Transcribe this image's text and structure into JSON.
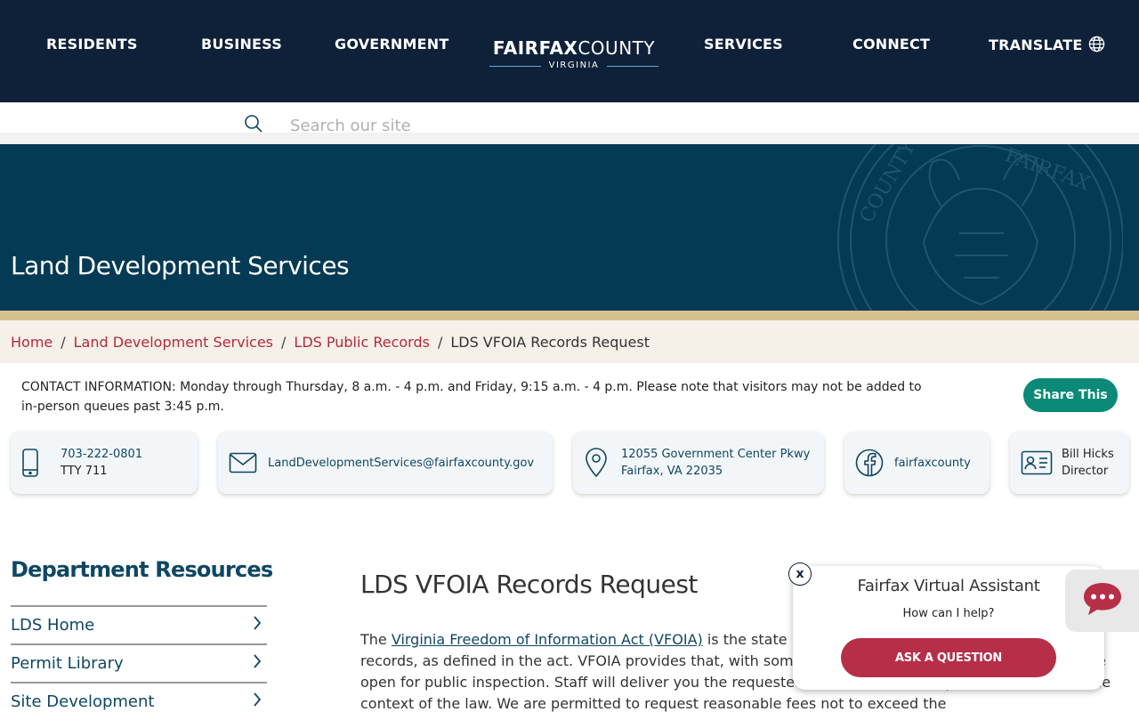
{
  "nav": {
    "items": [
      "RESIDENTS",
      "BUSINESS",
      "GOVERNMENT",
      "SERVICES",
      "CONNECT",
      "TRANSLATE"
    ],
    "logo_bold": "FAIRFAX",
    "logo_light": "COUNTY",
    "logo_sub": "VIRGINIA"
  },
  "search": {
    "placeholder": "Search our site"
  },
  "hero": {
    "title": "Land Development Services"
  },
  "breadcrumb": {
    "items": [
      "Home",
      "Land Development Services",
      "LDS Public Records"
    ],
    "current": "LDS VFOIA Records Request",
    "separator": "/"
  },
  "contact": {
    "info": "CONTACT INFORMATION: Monday through Thursday, 8 a.m. - 4 p.m. and Friday, 9:15 a.m. - 4 p.m. Please note that visitors may not be added to in-person queues past 3:45 p.m.",
    "share_label": "Share This",
    "phone": "703-222-0801",
    "tty": "TTY 711",
    "email": "LandDevelopmentServices@fairfaxcounty.gov",
    "address_line1": "12055 Government Center Pkwy",
    "address_line2": "Fairfax, VA 22035",
    "facebook": "fairfaxcounty",
    "director_name": "Bill Hicks",
    "director_title": "Director"
  },
  "sidebar": {
    "title": "Department Resources",
    "items": [
      "LDS Home",
      "Permit Library",
      "Site Development"
    ]
  },
  "main": {
    "title": "LDS VFOIA Records Request",
    "body_prefix": "The ",
    "body_link": "Virginia Freedom of Information Act (VFOIA)",
    "body_rest": " is the state law that ensures public access to public records, as defined in the act. VFOIA provides that, with some specific exemptions, all public records are open for public inspection. Staff will deliver you the requested records as soon as possible and within the context of the law. We are permitted to request reasonable fees not to exceed the"
  },
  "chat": {
    "title": "Fairfax Virtual Assistant",
    "subtitle": "How can I help?",
    "button": "ASK A QUESTION",
    "close": "x"
  },
  "colors": {
    "nav_bg": "#0e2139",
    "hero_bg": "#053a54",
    "accent_red": "#b02b3d",
    "teal": "#0a8a77",
    "tan": "#d7c08f"
  }
}
